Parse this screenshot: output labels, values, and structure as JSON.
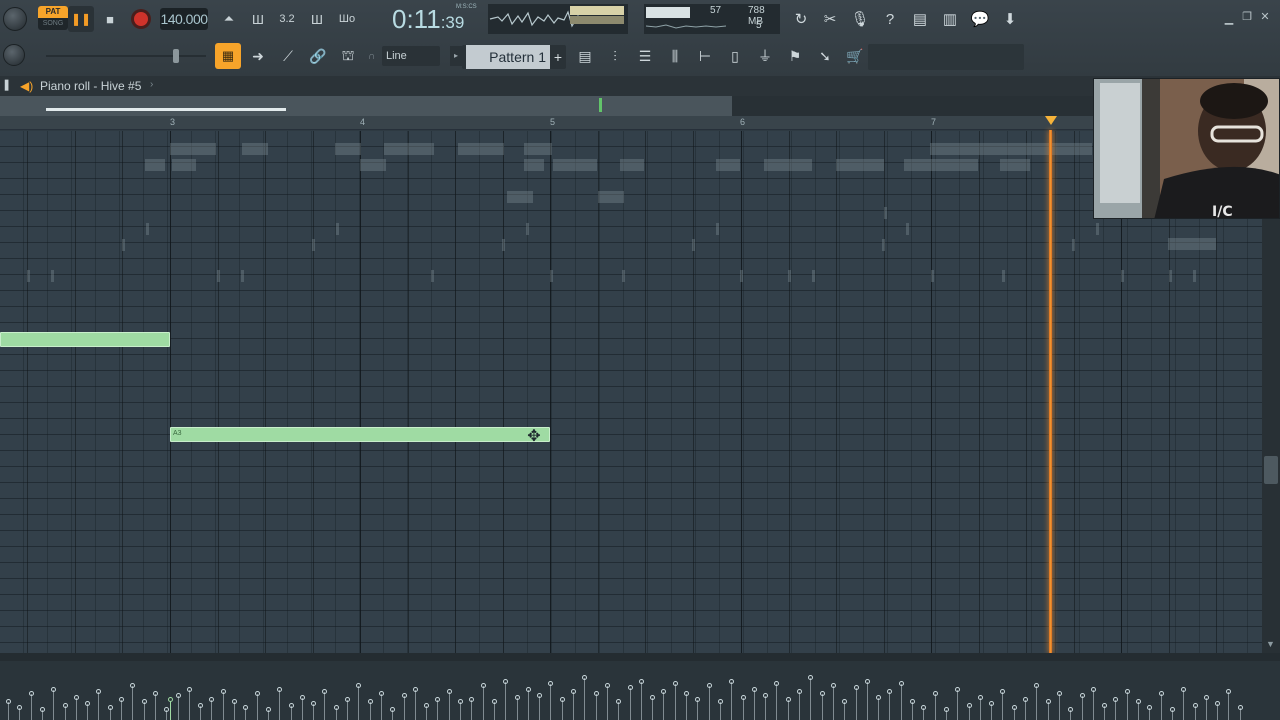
{
  "toolbar": {
    "pat_label": "PAT",
    "song_label": "SONG",
    "tempo": "140.000",
    "time_main": "0:11",
    "time_sub": ":39",
    "time_format": "M:S:CS",
    "cpu_value": "57",
    "memory": "788 MB",
    "polyphony": "5",
    "snap_mode": "Line",
    "pattern_name": "Pattern 1",
    "pattern_add": "+",
    "icons_row1": [
      "master-volume-knob",
      "pause",
      "stop",
      "record",
      "metronome",
      "wait-for-input",
      "countdown",
      "step-edit",
      "blend-notes",
      "undo",
      "cut",
      "mic",
      "help",
      "save",
      "render",
      "chat",
      "download"
    ],
    "icons_row2": [
      "master-pitch-knob",
      "keyboard-mode",
      "arrow",
      "brush",
      "link",
      "stamp",
      "playlist",
      "piano-roll",
      "channel-rack",
      "mixer",
      "browser",
      "plugin",
      "tempo",
      "shop"
    ]
  },
  "piano_roll": {
    "title": "Piano roll - Hive #5",
    "bar_numbers": [
      "3",
      "4",
      "5",
      "6",
      "7"
    ],
    "note_label": "A3"
  },
  "colors": {
    "accent": "#f7a42a",
    "note": "#9fdba3",
    "playhead": "#f59d34",
    "grid_bg": "#33404a"
  }
}
